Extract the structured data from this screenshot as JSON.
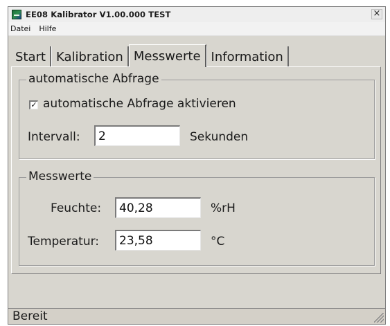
{
  "window": {
    "title": "EE08 Kalibrator V1.00.000 TEST",
    "close_glyph": "×"
  },
  "menu": {
    "items": [
      "Datei",
      "Hilfe"
    ]
  },
  "tabs": {
    "items": [
      "Start",
      "Kalibration",
      "Messwerte",
      "Information"
    ],
    "active": "Messwerte"
  },
  "auto_query": {
    "legend": "automatische Abfrage",
    "checkbox_label": "automatische Abfrage aktivieren",
    "checkbox_checked": true,
    "check_glyph": "✓",
    "interval_label": "Intervall:",
    "interval_value": "2",
    "interval_unit": "Sekunden"
  },
  "measurements": {
    "legend": "Messwerte",
    "humidity_label": "Feuchte:",
    "humidity_value": "40,28",
    "humidity_unit": "%rH",
    "temperature_label": "Temperatur:",
    "temperature_value": "23,58",
    "temperature_unit": "°C"
  },
  "status": {
    "text": "Bereit"
  }
}
